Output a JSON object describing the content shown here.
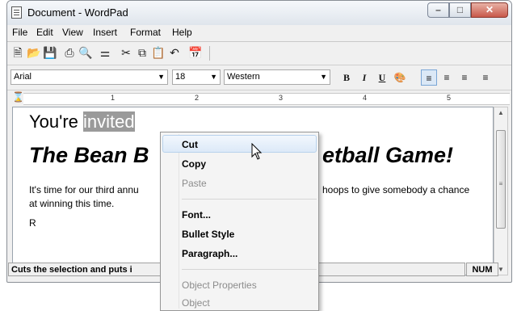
{
  "window": {
    "title": "Document - WordPad"
  },
  "menu": [
    "File",
    "Edit",
    "View",
    "Insert",
    "Format",
    "Help"
  ],
  "format": {
    "font": "Arial",
    "size": "18",
    "script": "Western",
    "bold": "B",
    "italic": "I",
    "underline": "U"
  },
  "ruler": [
    "1",
    "2",
    "3",
    "4",
    "5"
  ],
  "document": {
    "line1_before": "You're ",
    "line1_selected": "invited",
    "heading_left": "The Bean B",
    "heading_right": "etball Game!",
    "para1_left": "It's time for our third annu",
    "para1_right": "hoops to give somebody a chance",
    "para1_line2": "at winning this time.",
    "para2_partial": "R"
  },
  "status": {
    "text": "Cuts the selection and puts i",
    "num": "NUM"
  },
  "context_menu": {
    "items": [
      {
        "label": "Cut",
        "enabled": true
      },
      {
        "label": "Copy",
        "enabled": true
      },
      {
        "label": "Paste",
        "enabled": false
      },
      {
        "label": "Font...",
        "enabled": true
      },
      {
        "label": "Bullet Style",
        "enabled": true
      },
      {
        "label": "Paragraph...",
        "enabled": true
      },
      {
        "label": "Object Properties",
        "enabled": false
      },
      {
        "label": "Object",
        "enabled": false
      }
    ]
  },
  "colors": {
    "selection": "#9a9a9a",
    "highlight": "#dce9f8",
    "close_button": "#c8584a"
  }
}
